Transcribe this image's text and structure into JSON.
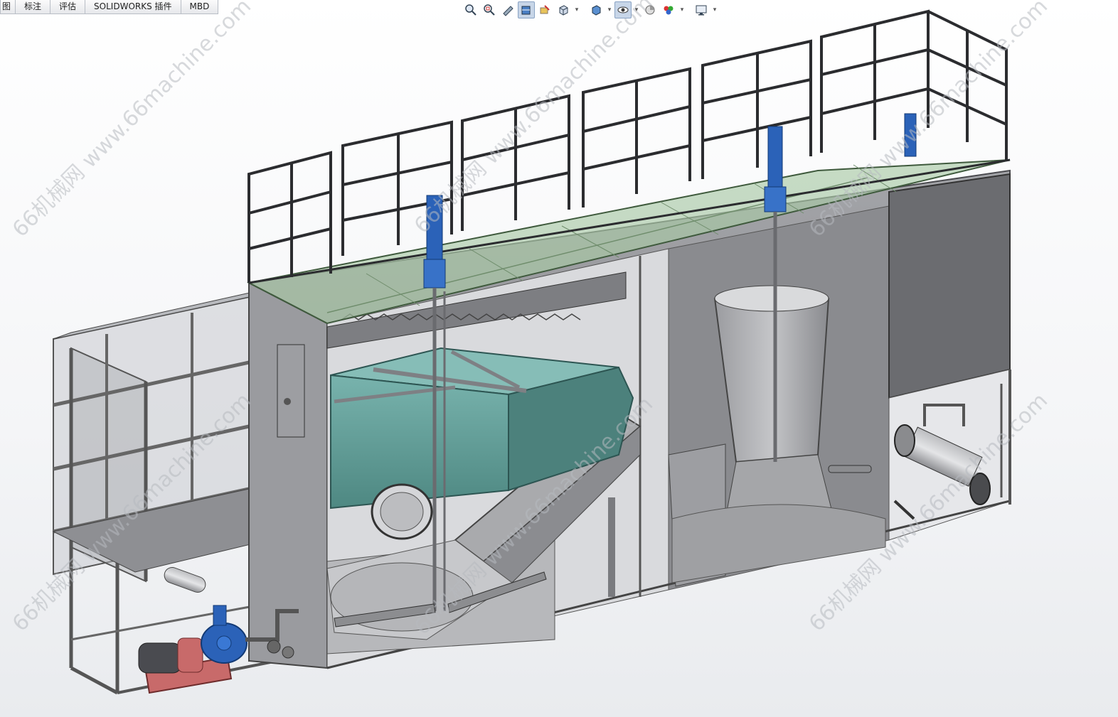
{
  "tabs": [
    {
      "label": "图"
    },
    {
      "label": "标注"
    },
    {
      "label": "评估"
    },
    {
      "label": "SOLIDWORKS 插件"
    },
    {
      "label": "MBD"
    }
  ],
  "toolbar": {
    "icons": [
      "zoom-to-fit-icon",
      "zoom-to-area-icon",
      "previous-view-icon",
      "section-view-icon",
      "dynamic-annotation-icon",
      "view-orientation-icon",
      "display-style-icon",
      "hide-show-items-icon",
      "edit-appearance-icon",
      "apply-scene-icon",
      "view-settings-icon"
    ]
  },
  "watermark": {
    "text": "66机械网 www.66machine.com"
  },
  "colors": {
    "steel": "#8e8e92",
    "steel_dark": "#5f6064",
    "teal_tank": "#5f9c97",
    "glass_green": "#a9c9a6",
    "motor_blue": "#2b62b8",
    "base_red": "#c86a6a"
  }
}
